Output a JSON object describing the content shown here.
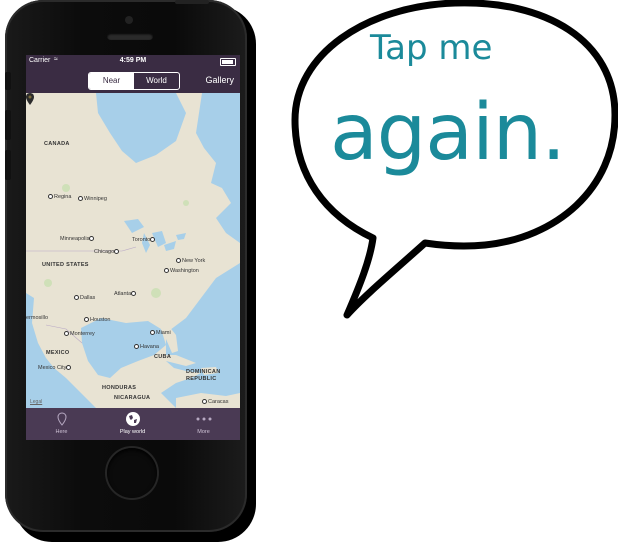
{
  "status_bar": {
    "carrier": "Carrier",
    "time": "4:59 PM"
  },
  "navbar": {
    "seg_near": "Near",
    "seg_world": "World",
    "gallery": "Gallery",
    "selected": "Near"
  },
  "map": {
    "labels": {
      "canada": "CANADA",
      "regina": "Regina",
      "winnipeg": "Winnipeg",
      "minneapolis": "Minneapolis",
      "toronto": "Toronto",
      "chicago": "Chicago",
      "new_york": "New York",
      "washington": "Washington",
      "united_states": "UNITED STATES",
      "dallas": "Dallas",
      "atlanta": "Atlanta",
      "houston": "Houston",
      "hermosillo": "ermosillo",
      "monterrey": "Monterrey",
      "mexico": "MEXICO",
      "miami": "Miami",
      "havana": "Havana",
      "cuba": "CUBA",
      "mexico_city": "Mexico City",
      "dominican": "DOMINICAN",
      "republic": "REPUBLIC",
      "honduras": "HONDURAS",
      "nicaragua": "NICARAGUA",
      "caracas": "Caracas",
      "legal": "Legal"
    }
  },
  "tabbar": {
    "here": "Here",
    "play_world": "Play world",
    "more": "More",
    "active": "Play world"
  },
  "bubble": {
    "line1": "Tap me",
    "line2": "again."
  },
  "colors": {
    "brand_purple": "#3a2c43",
    "tab_purple": "#4a3a54",
    "bubble_text": "#1b8a9a",
    "water": "#a7cfe9"
  }
}
